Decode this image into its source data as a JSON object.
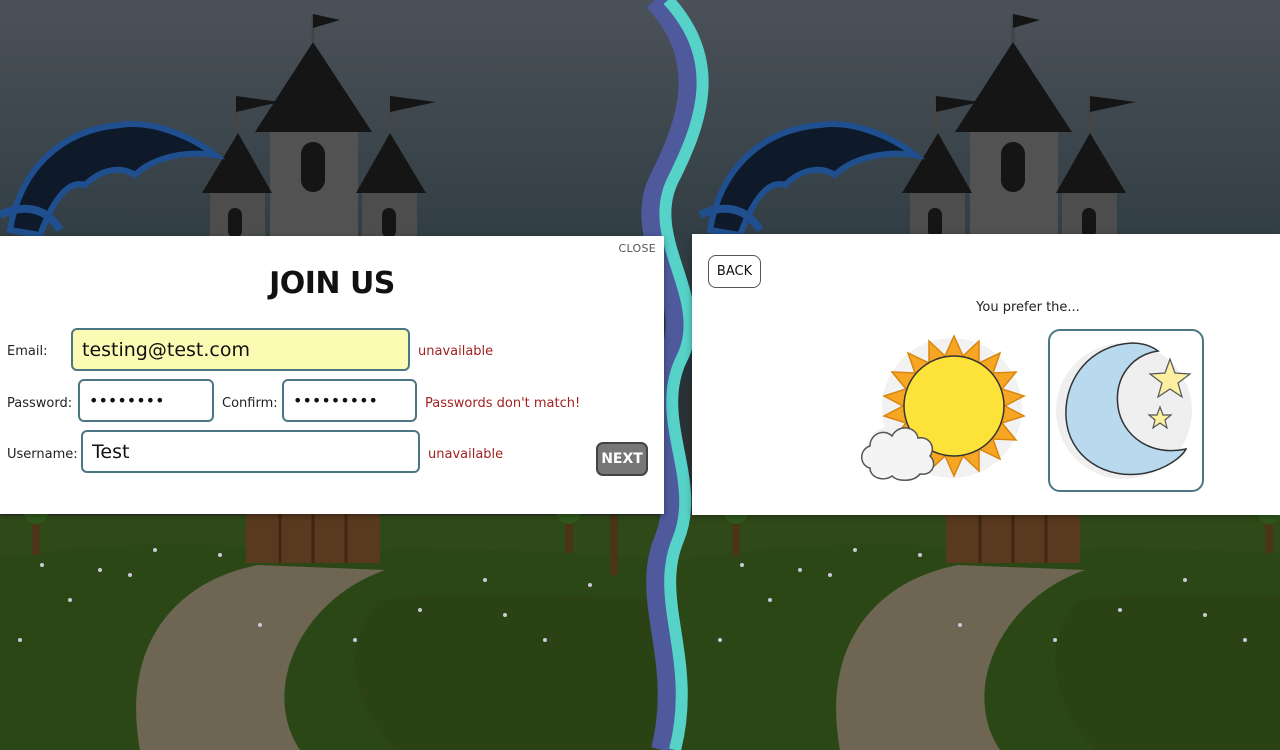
{
  "signup": {
    "close_label": "CLOSE",
    "title": "JOIN US",
    "email": {
      "label": "Email:",
      "value": "testing@test.com",
      "error": "unavailable"
    },
    "password": {
      "label": "Password:",
      "value": "••••••••"
    },
    "confirm": {
      "label": "Confirm:",
      "value": "•••••••••",
      "error": "Passwords don't match!"
    },
    "username": {
      "label": "Username:",
      "value": "Test",
      "error": "unavailable"
    },
    "next_label": "NEXT"
  },
  "preference": {
    "back_label": "BACK",
    "prompt": "You prefer the...",
    "options": [
      {
        "name": "day",
        "icon": "sun-icon"
      },
      {
        "name": "night",
        "icon": "moon-icon"
      }
    ]
  },
  "colors": {
    "divider_dark": "#4e5a9c",
    "divider_light": "#56d2c9",
    "error_text": "#a02222",
    "invalid_field_bg": "#fbfbb4",
    "field_border": "#4d7684"
  }
}
